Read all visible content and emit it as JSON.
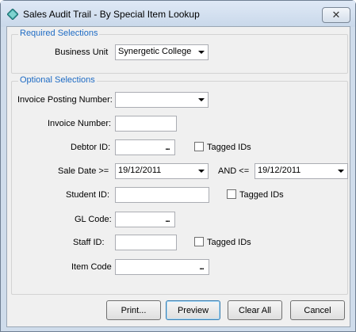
{
  "window": {
    "title": "Sales Audit Trail - By Special Item Lookup",
    "close_glyph": "✕"
  },
  "required": {
    "legend": "Required Selections",
    "business_unit_label": "Business Unit",
    "business_unit_value": "Synergetic College"
  },
  "optional": {
    "legend": "Optional Selections",
    "invoice_posting_number_label": "Invoice Posting Number:",
    "invoice_posting_number_value": "",
    "invoice_number_label": "Invoice Number:",
    "invoice_number_value": "",
    "debtor_id_label": "Debtor ID:",
    "debtor_id_value": "",
    "debtor_tagged_label": "Tagged IDs",
    "sale_date_from_label": "Sale Date >=",
    "sale_date_from_value": "19/12/2011",
    "sale_date_to_label": "AND <=",
    "sale_date_to_value": "19/12/2011",
    "student_id_label": "Student ID:",
    "student_id_value": "",
    "student_tagged_label": "Tagged IDs",
    "gl_code_label": "GL Code:",
    "gl_code_value": "",
    "staff_id_label": "Staff ID:",
    "staff_id_value": "",
    "staff_tagged_label": "Tagged IDs",
    "item_code_label": "Item Code",
    "item_code_value": "",
    "lookup_glyph": "..."
  },
  "buttons": {
    "print": "Print...",
    "preview": "Preview",
    "clear_all": "Clear All",
    "cancel": "Cancel"
  },
  "colors": {
    "group_label": "#1e6bc4",
    "client_bg": "#f0f0f0",
    "frame": "#cfdceb"
  }
}
